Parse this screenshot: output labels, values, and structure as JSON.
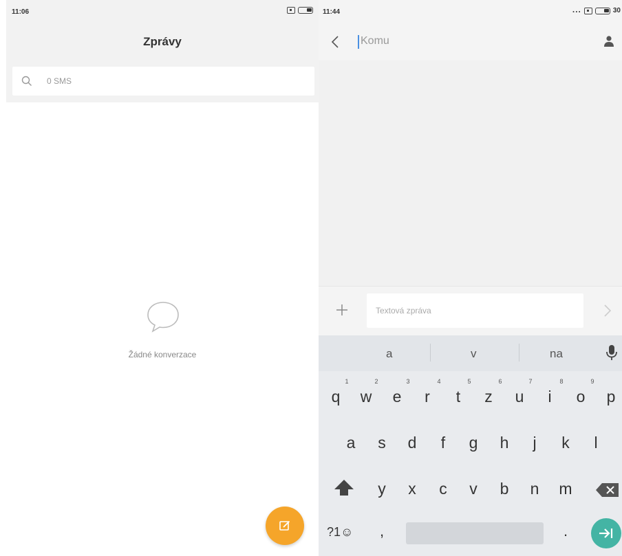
{
  "left_screen": {
    "status_time": "11:06",
    "title": "Zprávy",
    "search_placeholder": "0 SMS",
    "empty_message": "Žádné konverzace",
    "fab_icon": "compose-icon",
    "accent_color": "#f5a52a"
  },
  "right_screen": {
    "status_time": "11:44",
    "status_dots": "...",
    "battery_percent": "30",
    "to_placeholder": "Komu",
    "message_placeholder": "Textová zpráva",
    "keyboard": {
      "suggestions": [
        "a",
        "v",
        "na"
      ],
      "row1": [
        "q",
        "w",
        "e",
        "r",
        "t",
        "z",
        "u",
        "i",
        "o",
        "p"
      ],
      "row1_hints": [
        "1",
        "2",
        "3",
        "4",
        "5",
        "6",
        "7",
        "8",
        "9"
      ],
      "row2": [
        "a",
        "s",
        "d",
        "f",
        "g",
        "h",
        "j",
        "k",
        "l"
      ],
      "row3": [
        "y",
        "x",
        "c",
        "v",
        "b",
        "n",
        "m"
      ],
      "symbols_label": "?1☺",
      "comma": ",",
      "period": ".",
      "enter_color": "#44b4a4"
    }
  }
}
